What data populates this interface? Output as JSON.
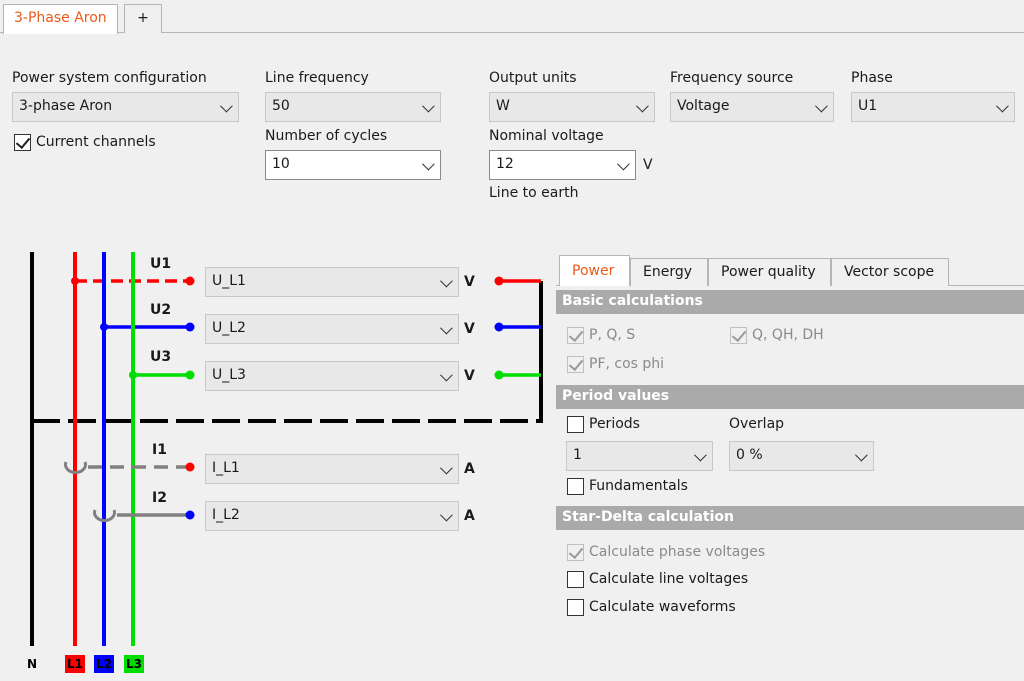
{
  "tabs": {
    "active": "3-Phase Aron",
    "add": "+"
  },
  "config": {
    "power_system": {
      "label": "Power system configuration",
      "value": "3-phase Aron"
    },
    "current_channels": {
      "label": "Current channels",
      "checked": true
    },
    "line_frequency": {
      "label": "Line frequency",
      "value": "50"
    },
    "number_of_cycles": {
      "label": "Number of cycles",
      "value": "10"
    },
    "output_units": {
      "label": "Output units",
      "value": "W"
    },
    "nominal_voltage": {
      "label": "Nominal voltage",
      "value": "12",
      "unit": "V",
      "note": "Line to earth"
    },
    "frequency_source": {
      "label": "Frequency source",
      "value": "Voltage"
    },
    "phase": {
      "label": "Phase",
      "value": "U1"
    }
  },
  "diagram": {
    "channels": [
      {
        "name": "U1",
        "value": "U_L1",
        "unit": "V"
      },
      {
        "name": "U2",
        "value": "U_L2",
        "unit": "V"
      },
      {
        "name": "U3",
        "value": "U_L3",
        "unit": "V"
      },
      {
        "name": "I1",
        "value": "I_L1",
        "unit": "A"
      },
      {
        "name": "I2",
        "value": "I_L2",
        "unit": "A"
      }
    ],
    "wires": [
      "N",
      "L1",
      "L2",
      "L3"
    ],
    "colors": {
      "L1": "#ff0000",
      "L2": "#0000ff",
      "L3": "#00cc00",
      "N": "#000000",
      "current": "#808080"
    }
  },
  "panel": {
    "tabs": [
      "Power",
      "Energy",
      "Power quality",
      "Vector scope"
    ],
    "basic": {
      "header": "Basic calculations",
      "pqs": "P, Q, S",
      "qqhdh": "Q, QH, DH",
      "pf": "PF, cos phi"
    },
    "period": {
      "header": "Period values",
      "periods": "Periods",
      "overlap_label": "Overlap",
      "periods_value": "1",
      "overlap_value": "0 %",
      "fundamentals": "Fundamentals"
    },
    "star_delta": {
      "header": "Star-Delta calculation",
      "phase_voltages": "Calculate phase voltages",
      "line_voltages": "Calculate line voltages",
      "waveforms": "Calculate waveforms"
    }
  },
  "accent_color": "#ea5a19"
}
